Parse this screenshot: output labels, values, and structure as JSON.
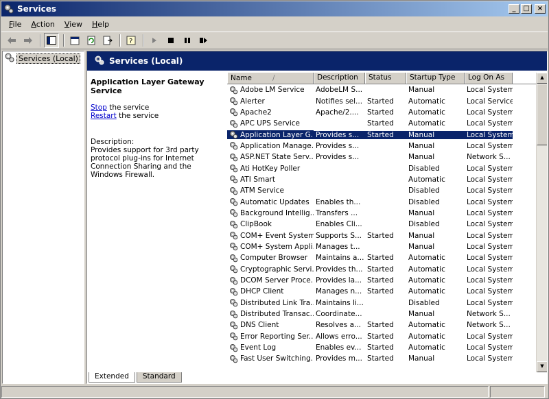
{
  "window": {
    "title": "Services",
    "minimize_label": "_",
    "maximize_label": "□",
    "close_label": "×"
  },
  "menu": [
    "File",
    "Action",
    "View",
    "Help"
  ],
  "menu_underline": [
    "F",
    "A",
    "V",
    "H"
  ],
  "toolbar_icons": [
    "back-arrow-icon",
    "forward-arrow-icon",
    "show-hide-tree-icon",
    "properties-icon",
    "refresh-icon",
    "export-list-icon",
    "help-icon",
    "start-service-icon",
    "stop-service-icon",
    "pause-service-icon",
    "restart-service-icon"
  ],
  "tree": {
    "root_label": "Services (Local)"
  },
  "pane": {
    "title": "Services (Local)",
    "selected_service": "Application Layer Gateway Service",
    "stop_link": "Stop",
    "stop_suffix": " the service",
    "restart_link": "Restart",
    "restart_suffix": " the service",
    "description_heading": "Description:",
    "description_text": "Provides support for 3rd party protocol plug-ins for Internet Connection Sharing and the Windows Firewall."
  },
  "columns": [
    "Name",
    "Description",
    "Status",
    "Startup Type",
    "Log On As"
  ],
  "sort_indicator": "/",
  "services": [
    [
      "Adobe LM Service",
      "AdobeLM S...",
      "",
      "Manual",
      "Local System"
    ],
    [
      "Alerter",
      "Notifies sel...",
      "Started",
      "Automatic",
      "Local Service"
    ],
    [
      "Apache2",
      "Apache/2....",
      "Started",
      "Automatic",
      "Local System"
    ],
    [
      "APC UPS Service",
      "",
      "Started",
      "Automatic",
      "Local System"
    ],
    [
      "Application Layer G...",
      "Provides s...",
      "Started",
      "Manual",
      "Local System"
    ],
    [
      "Application Manage...",
      "Provides s...",
      "",
      "Manual",
      "Local System"
    ],
    [
      "ASP.NET State Serv...",
      "Provides s...",
      "",
      "Manual",
      "Network S..."
    ],
    [
      "Ati HotKey Poller",
      "",
      "",
      "Disabled",
      "Local System"
    ],
    [
      "ATI Smart",
      "",
      "",
      "Automatic",
      "Local System"
    ],
    [
      "ATM Service",
      "",
      "",
      "Disabled",
      "Local System"
    ],
    [
      "Automatic Updates",
      "Enables th...",
      "",
      "Disabled",
      "Local System"
    ],
    [
      "Background Intellig...",
      "Transfers ...",
      "",
      "Manual",
      "Local System"
    ],
    [
      "ClipBook",
      "Enables Cli...",
      "",
      "Disabled",
      "Local System"
    ],
    [
      "COM+ Event System",
      "Supports S...",
      "Started",
      "Manual",
      "Local System"
    ],
    [
      "COM+ System Appli...",
      "Manages t...",
      "",
      "Manual",
      "Local System"
    ],
    [
      "Computer Browser",
      "Maintains a...",
      "Started",
      "Automatic",
      "Local System"
    ],
    [
      "Cryptographic Servi...",
      "Provides th...",
      "Started",
      "Automatic",
      "Local System"
    ],
    [
      "DCOM Server Proce...",
      "Provides la...",
      "Started",
      "Automatic",
      "Local System"
    ],
    [
      "DHCP Client",
      "Manages n...",
      "Started",
      "Automatic",
      "Local System"
    ],
    [
      "Distributed Link Tra...",
      "Maintains li...",
      "",
      "Disabled",
      "Local System"
    ],
    [
      "Distributed Transac...",
      "Coordinate...",
      "",
      "Manual",
      "Network S..."
    ],
    [
      "DNS Client",
      "Resolves a...",
      "Started",
      "Automatic",
      "Network S..."
    ],
    [
      "Error Reporting Ser...",
      "Allows erro...",
      "Started",
      "Automatic",
      "Local System"
    ],
    [
      "Event Log",
      "Enables ev...",
      "Started",
      "Automatic",
      "Local System"
    ],
    [
      "Fast User Switching...",
      "Provides m...",
      "Started",
      "Manual",
      "Local System"
    ]
  ],
  "selected_index": 4,
  "tabs": [
    "Extended",
    "Standard"
  ]
}
